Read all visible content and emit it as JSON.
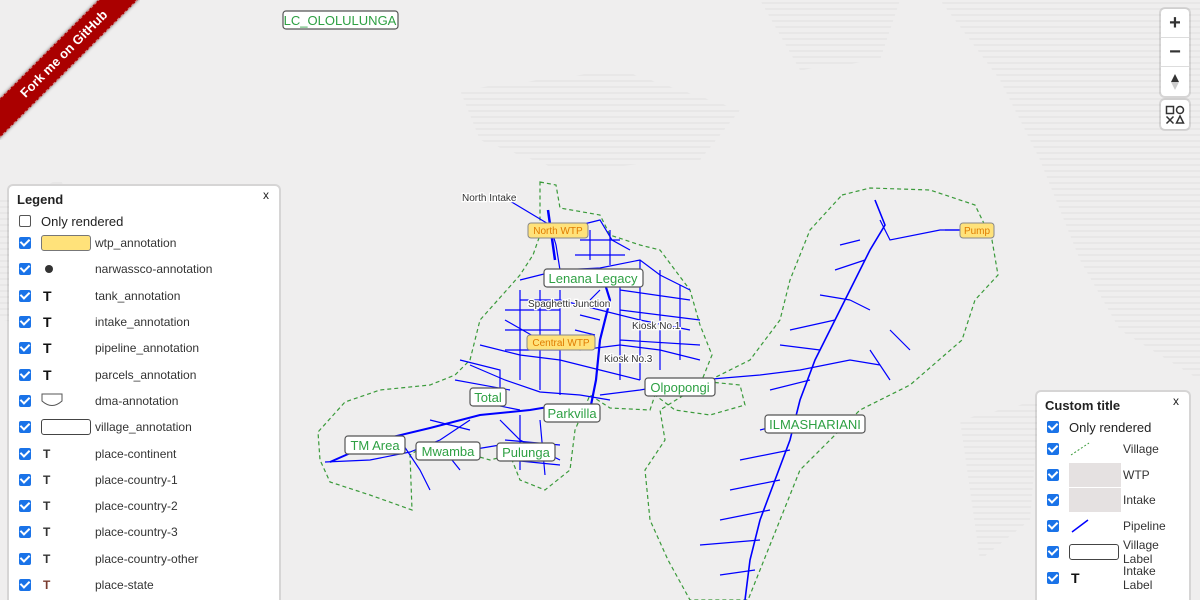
{
  "ribbon": {
    "text": "Fork me on GitHub"
  },
  "controls": {
    "zoom_in": "+",
    "zoom_out": "−"
  },
  "legend": {
    "title": "Legend",
    "close": "x",
    "only_rendered": "Only rendered",
    "items": [
      {
        "label": "wtp_annotation",
        "symbol": "yellow-box"
      },
      {
        "label": "narwassco-annotation",
        "symbol": "dot"
      },
      {
        "label": "tank_annotation",
        "symbol": "T"
      },
      {
        "label": "intake_annotation",
        "symbol": "T"
      },
      {
        "label": "pipeline_annotation",
        "symbol": "T"
      },
      {
        "label": "parcels_annotation",
        "symbol": "T"
      },
      {
        "label": "dma-annotation",
        "symbol": "shield-box"
      },
      {
        "label": "village_annotation",
        "symbol": "white-box"
      },
      {
        "label": "place-continent",
        "symbol": "T-small"
      },
      {
        "label": "place-country-1",
        "symbol": "T-small"
      },
      {
        "label": "place-country-2",
        "symbol": "T-small"
      },
      {
        "label": "place-country-3",
        "symbol": "T-small"
      },
      {
        "label": "place-country-other",
        "symbol": "T-small"
      },
      {
        "label": "place-state",
        "symbol": "T-brown"
      }
    ]
  },
  "custom_legend": {
    "title": "Custom title",
    "close": "x",
    "only_rendered": "Only rendered",
    "items": [
      {
        "label": "Village",
        "symbol": "dashed-line"
      },
      {
        "label": "WTP",
        "symbol": "grey-fill"
      },
      {
        "label": "Intake",
        "symbol": "grey-fill"
      },
      {
        "label": "Pipeline",
        "symbol": "blue-line"
      },
      {
        "label": "Village Label",
        "symbol": "white-box"
      },
      {
        "label": "Intake Label",
        "symbol": "T"
      }
    ]
  },
  "map_labels": {
    "lc": "LC_OLOLULUNGA",
    "north_wtp": "North WTP",
    "central_wtp": "Central WTP",
    "pump": "Pump",
    "north_intake": "North Intake",
    "spaghetti": "Spaghetti Junction",
    "kiosk1": "Kiosk No.1",
    "kiosk3": "Kiosk No.3",
    "lenana": "Lenana Legacy",
    "total": "Total",
    "parkvilla": "Parkvilla",
    "olpopongi": "Olpopongi",
    "ilmashariani": "ILMASHARIANI",
    "tm_area": "TM Area",
    "mwamba": "Mwamba",
    "pulunga": "Pulunga"
  },
  "colors": {
    "pipeline": "#0000ff",
    "village_border": "#3a9a3a",
    "village_text": "#2ea043",
    "wtp_fill": "#ffe27a",
    "wtp_text": "#e07b00",
    "checkbox": "#1a73e8"
  }
}
